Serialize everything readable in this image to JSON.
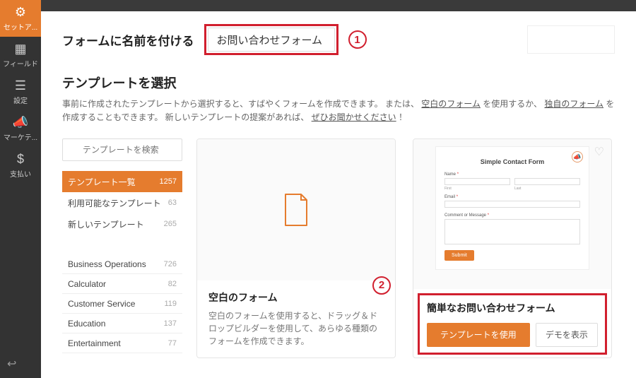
{
  "sidenav": {
    "items": [
      {
        "label": "セットア...",
        "key": "setup"
      },
      {
        "label": "フィールド",
        "key": "fields"
      },
      {
        "label": "設定",
        "key": "settings"
      },
      {
        "label": "マーケテ...",
        "key": "marketing"
      },
      {
        "label": "支払い",
        "key": "payment"
      }
    ],
    "back_icon": "↩"
  },
  "name_row": {
    "label": "フォームに名前を付ける",
    "value": "お問い合わせフォーム",
    "annotation": "1"
  },
  "templates": {
    "title": "テンプレートを選択",
    "desc_prefix": "事前に作成されたテンプレートから選択すると、すばやくフォームを作成できます。 または、",
    "link_blank": "空白のフォーム",
    "desc_mid": "を使用するか、",
    "link_custom": "独自のフォーム",
    "desc_suffix": "を作成することもできます。 新しいテンプレートの提案があれば、",
    "link_suggest": "ぜひお聞かせください",
    "desc_end": "！"
  },
  "search": {
    "placeholder": "テンプレートを検索"
  },
  "filters": [
    {
      "label": "テンプレート一覧",
      "count": "1257"
    },
    {
      "label": "利用可能なテンプレート",
      "count": "63"
    },
    {
      "label": "新しいテンプレート",
      "count": "265"
    }
  ],
  "categories": [
    {
      "label": "Business Operations",
      "count": "726"
    },
    {
      "label": "Calculator",
      "count": "82"
    },
    {
      "label": "Customer Service",
      "count": "119"
    },
    {
      "label": "Education",
      "count": "137"
    },
    {
      "label": "Entertainment",
      "count": "77"
    }
  ],
  "card_blank": {
    "title": "空白のフォーム",
    "desc": "空白のフォームを使用すると、ドラッグ＆ドロップビルダーを使用して、あらゆる種類のフォームを作成できます。",
    "annotation": "2"
  },
  "card_contact": {
    "title": "簡単なお問い合わせフォーム",
    "preview_title": "Simple Contact Form",
    "name_label": "Name",
    "first": "First",
    "last": "Last",
    "email_label": "Email",
    "msg_label": "Comment or Message",
    "submit": "Submit",
    "btn_use": "テンプレートを使用",
    "btn_demo": "デモを表示",
    "req": "*"
  },
  "colors": {
    "accent": "#e57c2e",
    "annotation": "#d11f2e"
  }
}
